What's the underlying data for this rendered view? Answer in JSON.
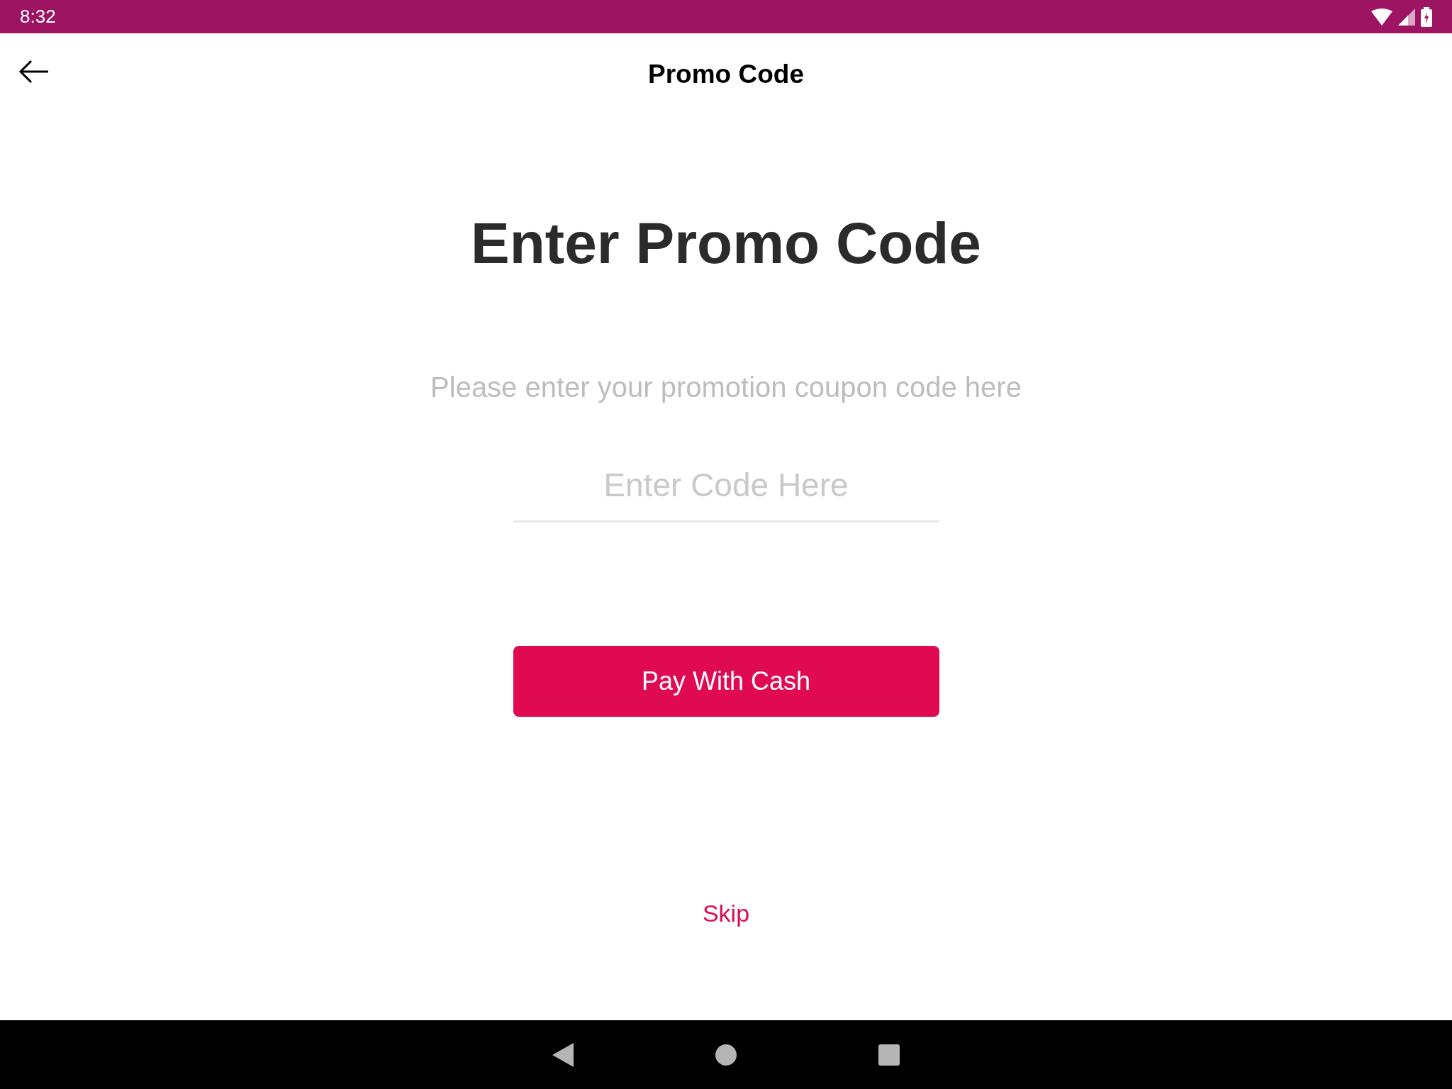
{
  "status_bar": {
    "time": "8:32"
  },
  "app_bar": {
    "title": "Promo Code"
  },
  "heading": "Enter Promo Code",
  "subtitle": "Please enter your promotion coupon code here",
  "code_field": {
    "placeholder": "Enter Code Here"
  },
  "primary_button": {
    "label": "Pay With Cash"
  },
  "skip_link": {
    "label": "Skip"
  }
}
